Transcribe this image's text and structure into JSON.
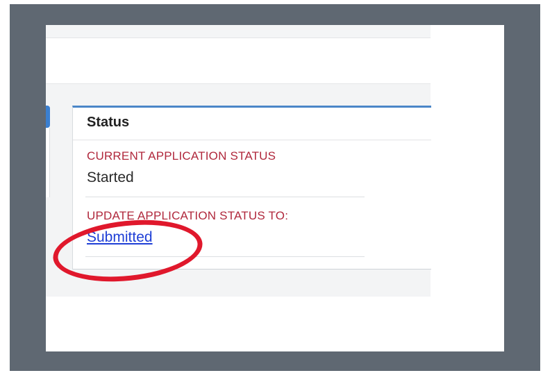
{
  "panel": {
    "title": "Status",
    "current_status_label": "CURRENT APPLICATION STATUS",
    "current_status_value": "Started",
    "update_status_label": "UPDATE APPLICATION STATUS TO:",
    "update_status_link": "Submitted"
  },
  "colors": {
    "label_red": "#b0283c",
    "link_blue": "#1f3fd6",
    "panel_accent": "#4a86c8",
    "annotation_red": "#e0182c",
    "frame_gray": "#5f6872"
  }
}
